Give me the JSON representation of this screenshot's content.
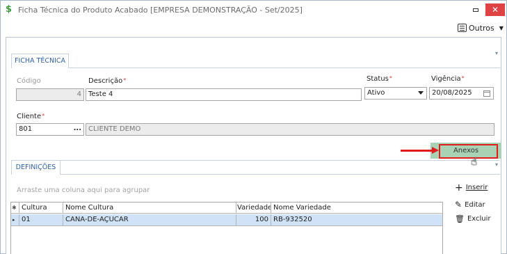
{
  "window": {
    "title": "Ficha Técnica do Produto Acabado [EMPRESA DEMONSTRAÇÃO - Set/2025]",
    "app_icon": "dollar-s-icon",
    "close_glyph": "✕"
  },
  "toolbar": {
    "outros_label": "Outros"
  },
  "tabs": {
    "ficha": "FICHA TÉCNICA",
    "definicoes": "DEFINIÇÕES"
  },
  "form": {
    "codigo": {
      "label": "Código",
      "value": "4"
    },
    "descricao": {
      "label": "Descrição",
      "value": "Teste 4"
    },
    "status": {
      "label": "Status",
      "value": "Ativo"
    },
    "vigencia": {
      "label": "Vigência",
      "value": "20/08/2025"
    },
    "cliente": {
      "label": "Cliente",
      "code": "801",
      "name": "CLIENTE DEMO",
      "lookup": "..."
    },
    "required_mark": "*"
  },
  "buttons": {
    "anexos": "Anexos",
    "inserir": "Inserir",
    "editar": "Editar",
    "excluir": "Excluir"
  },
  "grid": {
    "group_hint": "Arraste uma coluna aqui para agrupar",
    "columns": [
      "Cultura",
      "Nome Cultura",
      "Variedade",
      "Nome Variedade"
    ],
    "rows": [
      {
        "cultura": "01",
        "nome_cultura": "CANA-DE-AÇUCAR",
        "variedade": "100",
        "nome_variedade": "RB-932520"
      }
    ]
  },
  "colors": {
    "accent_tab": "#2f5fa5",
    "anexos_bg": "#a9d1b3",
    "close_bg": "#e04343",
    "highlight": "#e01b1b",
    "selected_row": "#cfe2f6"
  }
}
